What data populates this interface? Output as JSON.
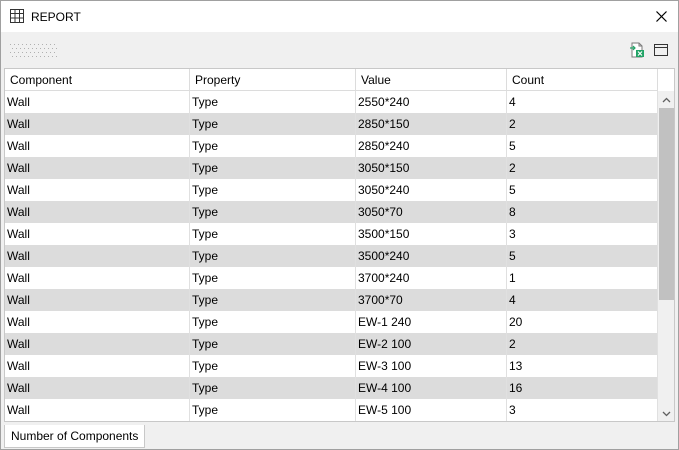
{
  "window": {
    "title": "REPORT"
  },
  "table": {
    "columns": [
      "Component",
      "Property",
      "Value",
      "Count"
    ],
    "rows": [
      [
        "Wall",
        "Type",
        "2550*240",
        "4"
      ],
      [
        "Wall",
        "Type",
        "2850*150",
        "2"
      ],
      [
        "Wall",
        "Type",
        "2850*240",
        "5"
      ],
      [
        "Wall",
        "Type",
        "3050*150",
        "2"
      ],
      [
        "Wall",
        "Type",
        "3050*240",
        "5"
      ],
      [
        "Wall",
        "Type",
        "3050*70",
        "8"
      ],
      [
        "Wall",
        "Type",
        "3500*150",
        "3"
      ],
      [
        "Wall",
        "Type",
        "3500*240",
        "5"
      ],
      [
        "Wall",
        "Type",
        "3700*240",
        "1"
      ],
      [
        "Wall",
        "Type",
        "3700*70",
        "4"
      ],
      [
        "Wall",
        "Type",
        "EW-1 240",
        "20"
      ],
      [
        "Wall",
        "Type",
        "EW-2 100",
        "2"
      ],
      [
        "Wall",
        "Type",
        "EW-3 100",
        "13"
      ],
      [
        "Wall",
        "Type",
        "EW-4 100",
        "16"
      ],
      [
        "Wall",
        "Type",
        "EW-5 100",
        "3"
      ]
    ]
  },
  "tabs": [
    {
      "label": "Number of Components"
    }
  ],
  "icons": {
    "title": "table-icon",
    "close": "close-icon",
    "export": "export-excel-icon",
    "layout": "window-layout-icon",
    "grip": "toolbar-grip-icon",
    "scroll_up": "scroll-up-icon",
    "scroll_down": "scroll-down-icon"
  },
  "colors": {
    "alt_row": "#dcdcdc",
    "window_bg": "#f0f0f0",
    "export_green": "#21a366"
  }
}
